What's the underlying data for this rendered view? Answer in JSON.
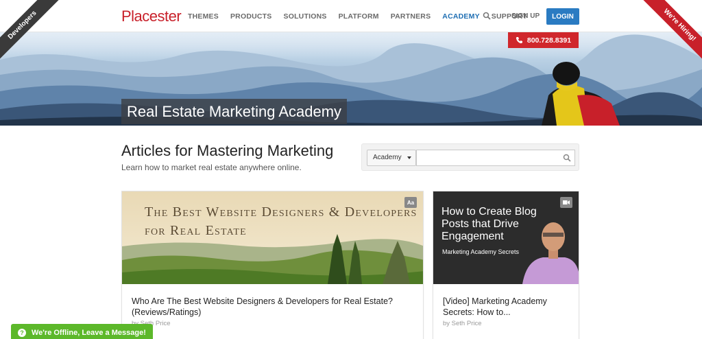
{
  "header": {
    "logo": "Placester",
    "nav": [
      "THEMES",
      "PRODUCTS",
      "SOLUTIONS",
      "PLATFORM",
      "PARTNERS",
      "ACADEMY",
      "SUPPORT"
    ],
    "active_nav": "ACADEMY",
    "signup_label": "SIGN UP",
    "login_label": "LOGIN",
    "ribbon_left": "Developers",
    "ribbon_right": "We're Hiring!",
    "phone": "800.728.8391"
  },
  "hero": {
    "title": "Real Estate Marketing Academy"
  },
  "articles": {
    "title": "Articles for Mastering Marketing",
    "subtitle": "Learn how to market real estate anywhere online.",
    "search": {
      "category": "Academy",
      "placeholder": ""
    }
  },
  "cards": [
    {
      "image_text": "The Best Website Designers & Developers for Real Estate",
      "badge": "Aa",
      "title": "Who Are The Best Website Designers & Developers for Real Estate? (Reviews/Ratings)",
      "byline": "by Seth Price"
    },
    {
      "image_title": "How to Create Blog Posts that Drive Engagement",
      "image_sub": "Marketing Academy Secrets",
      "title": "[Video] Marketing Academy Secrets: How to...",
      "byline": "by Seth Price"
    }
  ],
  "chat": {
    "label": "We're Offline, Leave a Message!"
  },
  "colors": {
    "brand": "#c8202a",
    "nav_active": "#1f6fb3",
    "login": "#2a7bc2",
    "chat": "#5cb82a"
  }
}
